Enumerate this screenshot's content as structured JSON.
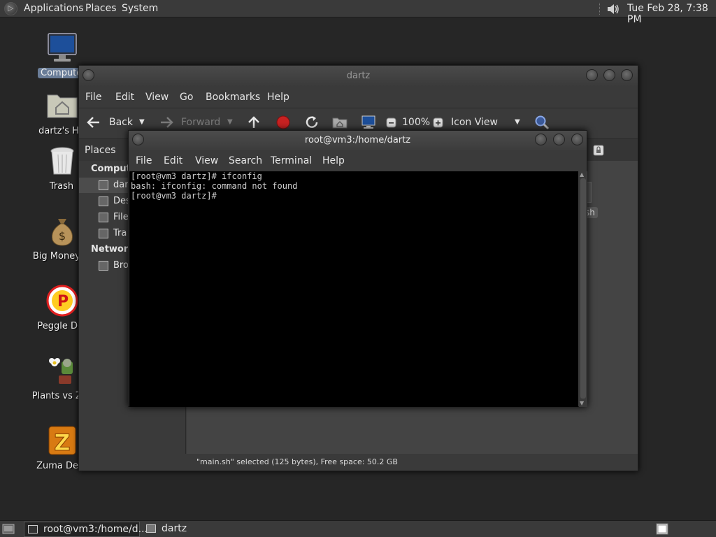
{
  "top_panel": {
    "menus": [
      "Applications",
      "Places",
      "System"
    ],
    "clock": "Tue Feb 28,  7:38 PM"
  },
  "desktop": {
    "icons": [
      {
        "label": "Compute",
        "icon": "computer-icon"
      },
      {
        "label": "dartz's Ho",
        "icon": "home-folder-icon"
      },
      {
        "label": "Trash",
        "icon": "trash-icon"
      },
      {
        "label": "Big Money D",
        "icon": "money-bag-icon"
      },
      {
        "label": "Peggle Del",
        "icon": "peggle-icon"
      },
      {
        "label": "Plants vs Zor",
        "icon": "plants-vs-zombies-icon"
      },
      {
        "label": "Zuma Delu",
        "icon": "zuma-icon"
      }
    ]
  },
  "file_manager": {
    "title": "dartz",
    "menus": [
      "File",
      "Edit",
      "View",
      "Go",
      "Bookmarks",
      "Help"
    ],
    "toolbar": {
      "back": "Back",
      "forward": "Forward",
      "zoom": "100%",
      "view_mode": "Icon View"
    },
    "places_label": "Places",
    "sidebar": {
      "computer_header": "Compute",
      "items": [
        "dar",
        "Des",
        "File",
        "Tra"
      ],
      "network_header": "Network",
      "network_items": [
        "Bro"
      ]
    },
    "content_fragment": "sh",
    "status": "\"main.sh\" selected (125 bytes), Free space: 50.2 GB"
  },
  "terminal": {
    "title": "root@vm3:/home/dartz",
    "menus": [
      "File",
      "Edit",
      "View",
      "Search",
      "Terminal",
      "Help"
    ],
    "output": "[root@vm3 dartz]# ifconfig\nbash: ifconfig: command not found\n[root@vm3 dartz]# "
  },
  "taskbar": {
    "tasks": [
      {
        "label": "root@vm3:/home/d...",
        "active": true
      },
      {
        "label": "dartz",
        "active": false
      }
    ]
  },
  "colors": {
    "panel": "#3a3a3a",
    "desktop": "#262626",
    "terminal_bg": "#000000",
    "selection": "#6a7d98"
  }
}
